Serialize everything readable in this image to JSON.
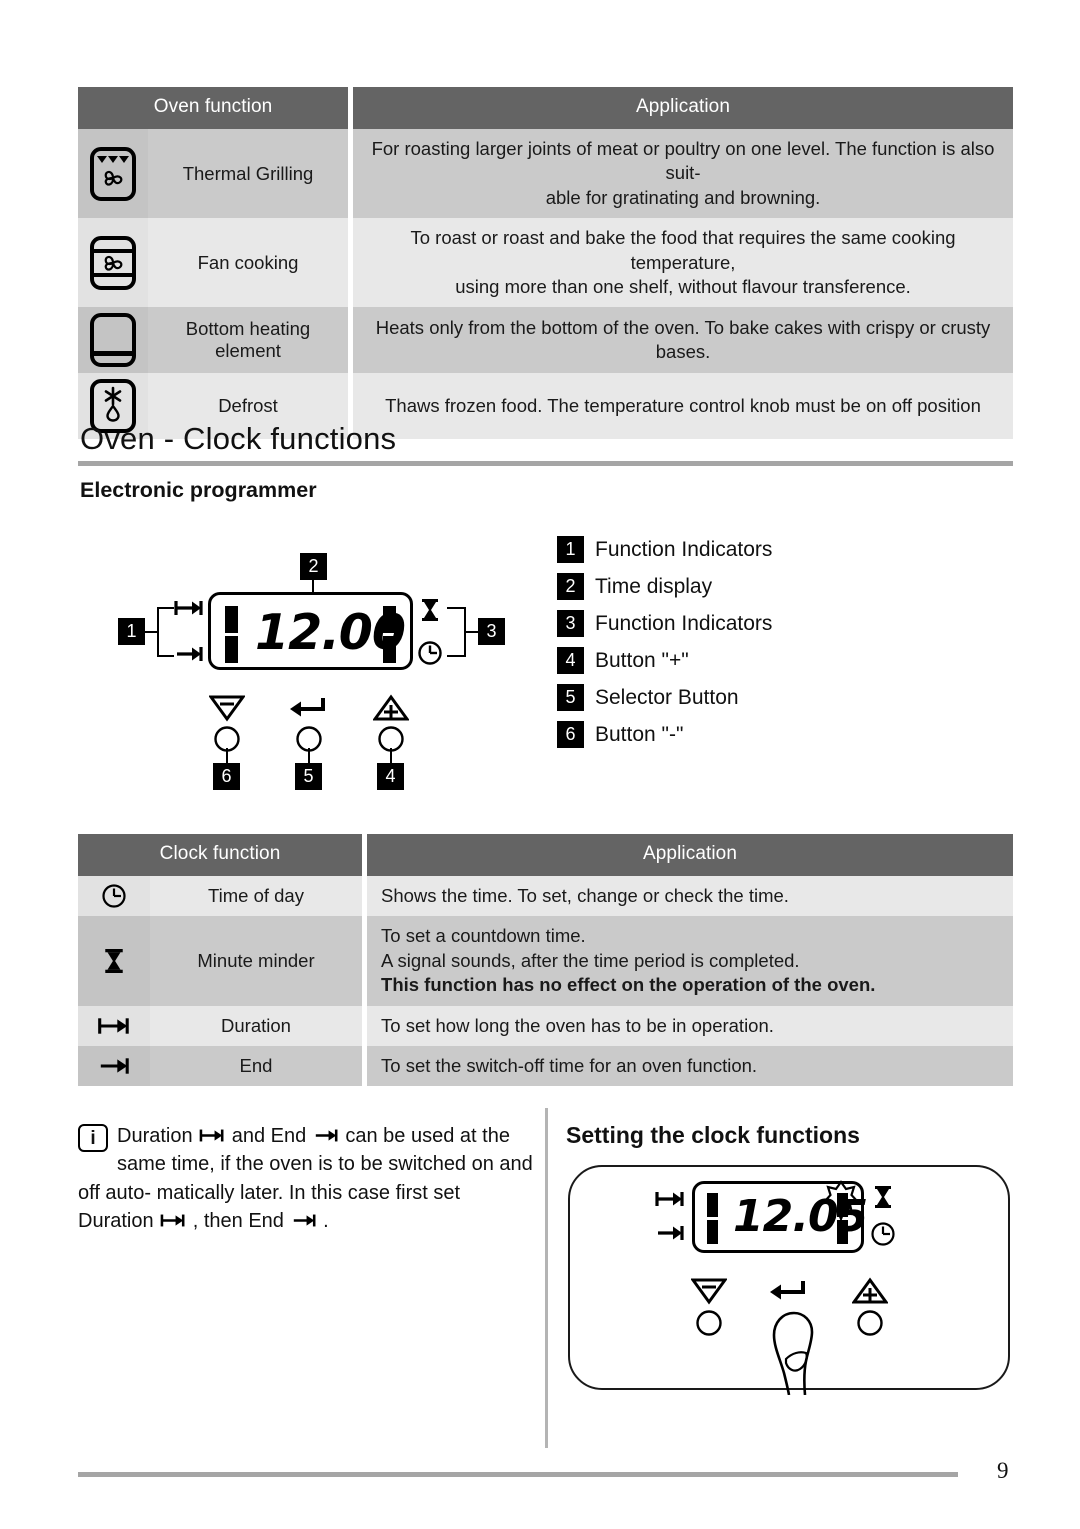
{
  "oven_function_table": {
    "headers": [
      "Oven function",
      "Application"
    ],
    "rows": [
      {
        "icon": "thermal-grilling-icon",
        "name": "Thermal Grilling",
        "application": "For roasting larger joints of meat or poultry on one level. The function is also suit-able for gratinating and browning.",
        "application_lines": [
          "For roasting larger joints of meat or poultry on one level. The function is also suit-",
          "able for gratinating and browning."
        ]
      },
      {
        "icon": "fan-cooking-icon",
        "name": "Fan cooking",
        "application": "To roast or roast and bake the food that requires the same cooking temperature, using more than one shelf, without flavour transference.",
        "application_lines": [
          "To roast or roast and bake the food that requires the same cooking temperature,",
          "using more than one shelf, without flavour transference."
        ]
      },
      {
        "icon": "bottom-heating-element-icon",
        "name": "Bottom heating element",
        "application": "Heats only from the bottom of the oven. To bake cakes with crispy or crusty bases.",
        "application_lines": [
          "Heats only from the bottom of the oven. To bake cakes with crispy or crusty bases."
        ]
      },
      {
        "icon": "defrost-icon",
        "name": "Defrost",
        "application": "Thaws frozen food. The temperature control knob must be on off position",
        "application_lines": [
          "Thaws frozen food. The temperature control knob must be on off position"
        ]
      }
    ]
  },
  "section": {
    "title": "Oven - Clock functions",
    "subtitle": "Electronic programmer"
  },
  "programmer_diagram": {
    "display_value": "12.00",
    "callouts": [
      "1",
      "2",
      "3",
      "4",
      "5",
      "6"
    ],
    "indicators_left": [
      "duration-indicator-icon",
      "end-indicator-icon"
    ],
    "indicators_right": [
      "minute-minder-icon",
      "time-of-day-icon"
    ],
    "buttons": [
      "minus-button-icon",
      "selector-button-icon",
      "plus-button-icon"
    ]
  },
  "legend": {
    "items": [
      {
        "num": "1",
        "label": "Function Indicators"
      },
      {
        "num": "2",
        "label": "Time display"
      },
      {
        "num": "3",
        "label": "Function Indicators"
      },
      {
        "num": "4",
        "label": "Button \"+\""
      },
      {
        "num": "5",
        "label": "Selector Button"
      },
      {
        "num": "6",
        "label": "Button \"-\""
      }
    ]
  },
  "clock_function_table": {
    "headers": [
      "Clock function",
      "Application"
    ],
    "rows": [
      {
        "icon": "time-of-day-icon",
        "name": "Time of day",
        "lines": [
          {
            "text": "Shows the time. To set, change or check the time.",
            "bold": false
          }
        ]
      },
      {
        "icon": "minute-minder-icon",
        "name": "Minute minder",
        "lines": [
          {
            "text": "To set a countdown time.",
            "bold": false
          },
          {
            "text": "A signal sounds, after the time period is completed.",
            "bold": false
          },
          {
            "text": "This function has no effect on the operation of the oven.",
            "bold": true
          }
        ]
      },
      {
        "icon": "duration-icon",
        "name": "Duration",
        "lines": [
          {
            "text": "To set how long the oven has to be in operation.",
            "bold": false
          }
        ]
      },
      {
        "icon": "end-icon",
        "name": "End",
        "lines": [
          {
            "text": "To set the switch-off time for an oven function.",
            "bold": false
          }
        ]
      }
    ]
  },
  "note": {
    "icon": "info-icon",
    "part1": "Duration",
    "part2": "and End",
    "part3": "can be used at the same",
    "part4": "time, if the oven is to be switched on and off auto-",
    "part5": "matically later. In this case first set Duration",
    "part6": ", then",
    "part7": "End",
    "part8": "."
  },
  "setting_section": {
    "title": "Setting the clock functions",
    "display_value": "12.05",
    "blinking_indicator": "flashing-indicator-icon",
    "pointer": "finger-pressing-icon"
  },
  "footer": {
    "page_number": "9"
  },
  "colors": {
    "header_bar": "#646464",
    "row_dark": "#cacaca",
    "row_light": "#e8e8e8",
    "rule": "#a5a5a5",
    "text": "#111111"
  }
}
